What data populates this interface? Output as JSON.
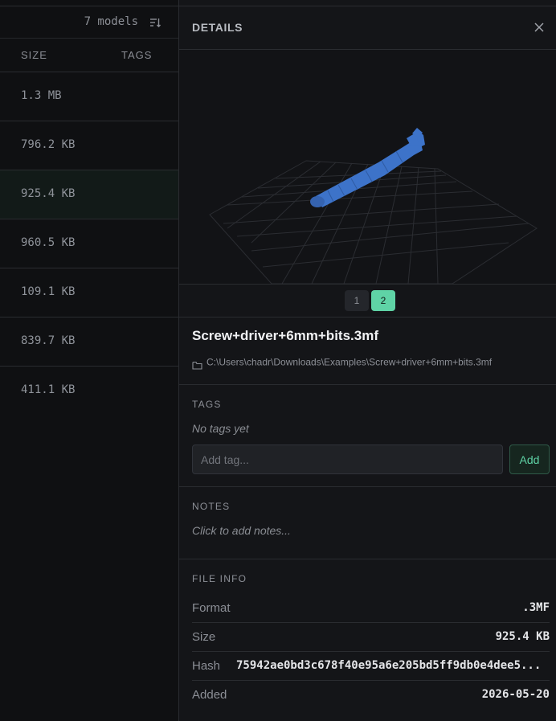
{
  "list": {
    "model_count": "7 models",
    "columns": {
      "size": "SIZE",
      "tags": "TAGS"
    },
    "rows": [
      {
        "size": "1.3 MB"
      },
      {
        "size": "796.2 KB"
      },
      {
        "size": "925.4 KB",
        "selected": true
      },
      {
        "size": "960.5 KB"
      },
      {
        "size": "109.1 KB"
      },
      {
        "size": "839.7 KB"
      },
      {
        "size": "411.1 KB"
      }
    ]
  },
  "details": {
    "title": "DETAILS",
    "pages": [
      "1",
      "2"
    ],
    "active_page": "2",
    "file_name": "Screw+driver+6mm+bits.3mf",
    "file_path": "C:\\Users\\chadr\\Downloads\\Examples\\Screw+driver+6mm+bits.3mf",
    "tags": {
      "label": "TAGS",
      "empty_text": "No tags yet",
      "input_placeholder": "Add tag...",
      "add_label": "Add"
    },
    "notes": {
      "label": "NOTES",
      "placeholder": "Click to add notes..."
    },
    "file_info": {
      "label": "FILE INFO",
      "rows": [
        {
          "label": "Format",
          "value": ".3MF"
        },
        {
          "label": "Size",
          "value": "925.4 KB"
        },
        {
          "label": "Hash",
          "value": "75942ae0bd3c678f40e95a6e205bd5ff9db0e4dee5..."
        },
        {
          "label": "Added",
          "value": "2026-05-20"
        }
      ]
    }
  },
  "colors": {
    "accent": "#5fd3a6",
    "model": "#3d73c9",
    "background": "#141518"
  },
  "icons": {
    "sort": "sort-icon",
    "close": "close-icon",
    "folder": "folder-icon"
  }
}
